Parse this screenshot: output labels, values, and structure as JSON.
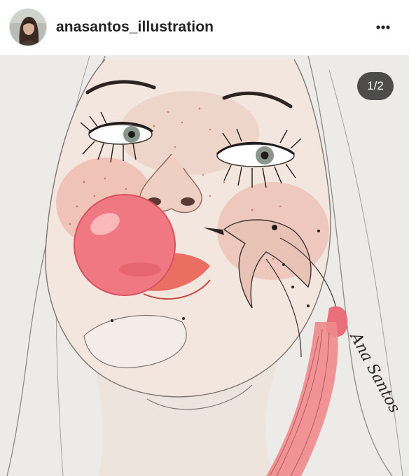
{
  "post": {
    "username": "anasantos_illustration",
    "more_icon": "more-horizontal-icon",
    "image_counter": "1/2",
    "signature": "Ana Santos"
  },
  "colors": {
    "paper": "#ededeb",
    "skin": "#f1e4dc",
    "blush": "#e88a78",
    "bubblegum": "#f06a76",
    "hair_pink": "#ef8a8c",
    "counter_bg": "#282828"
  }
}
